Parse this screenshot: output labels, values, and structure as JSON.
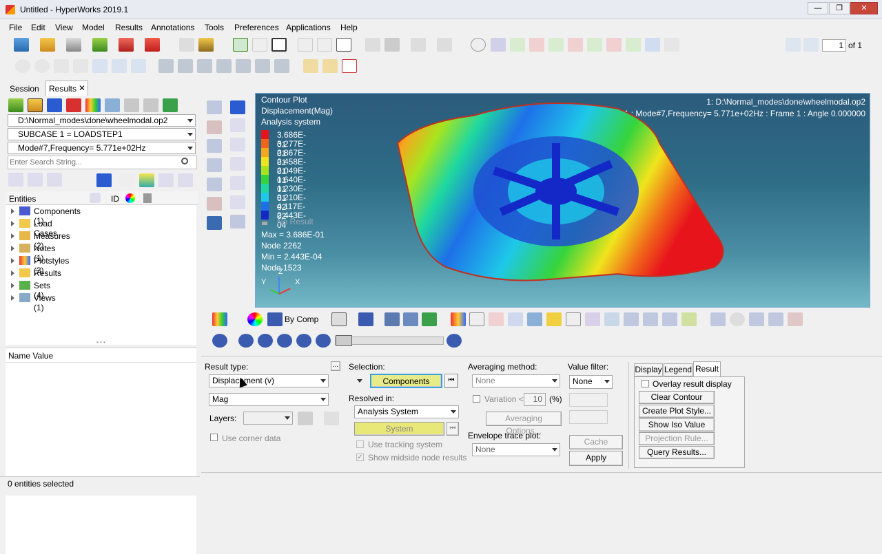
{
  "window": {
    "title": "Untitled - HyperWorks 2019.1",
    "min_glyph": "—",
    "max_glyph": "❐",
    "close_glyph": "✕"
  },
  "menu": [
    "File",
    "Edit",
    "View",
    "Model",
    "Results",
    "Annotations",
    "Tools",
    "Preferences",
    "Applications",
    "Help"
  ],
  "page_nav": {
    "current": "1",
    "total_label": "of 1"
  },
  "browser": {
    "tabs": {
      "session": "Session",
      "results": "Results",
      "close_glyph": "✕"
    },
    "file_path": "D:\\Normal_modes\\done\\wheelmodal.op2",
    "subcase": "SUBCASE 1 = LOADSTEP1",
    "mode": "Mode#7,Frequency=  5.771e+02Hz",
    "search_placeholder": "Enter Search String...",
    "columns": {
      "entities": "Entities",
      "id": "ID"
    },
    "tree": [
      {
        "label": "Components (1)",
        "icon": "components-icon"
      },
      {
        "label": "Load Cases",
        "icon": "folder-icon"
      },
      {
        "label": "Measures (2)",
        "icon": "measures-icon"
      },
      {
        "label": "Notes (1)",
        "icon": "notes-icon"
      },
      {
        "label": "Plotstyles (3)",
        "icon": "plotstyles-icon"
      },
      {
        "label": "Results",
        "icon": "folder-icon"
      },
      {
        "label": "Sets (4)",
        "icon": "sets-icon"
      },
      {
        "label": "Views (1)",
        "icon": "views-icon"
      }
    ],
    "name_value_header": "Name Value",
    "status": "0 entities selected"
  },
  "viewport": {
    "contour_title": "Contour Plot",
    "result_label": "Displacement(Mag)",
    "system_label": "Analysis system",
    "file_info": "1: D:\\Normal_modes\\done\\wheelmodal.op2",
    "subcase_info": "SUBCASE 1 = LOADSTEP1  : Mode#7,Frequency=   5.771e+02Hz : Frame 1 : Angle 0.000000",
    "legend": [
      {
        "value": "3.686E-01",
        "color": "#e8141c"
      },
      {
        "value": "3.277E-01",
        "color": "#f0641a"
      },
      {
        "value": "2.867E-01",
        "color": "#f4a81e"
      },
      {
        "value": "2.458E-01",
        "color": "#f0e41c"
      },
      {
        "value": "2.049E-01",
        "color": "#a8e41e"
      },
      {
        "value": "1.640E-01",
        "color": "#36d43c"
      },
      {
        "value": "1.230E-01",
        "color": "#1ed8a0"
      },
      {
        "value": "8.210E-02",
        "color": "#1ec8e8"
      },
      {
        "value": "4.117E-02",
        "color": "#1e70e8"
      },
      {
        "value": "2.443E-04",
        "color": "#1428c8"
      }
    ],
    "no_result": "No Result",
    "max_label": "Max =  3.686E-01",
    "max_node": "Node 2262",
    "min_label": "Min =  2.443E-04",
    "min_node": "Node 1523",
    "triad": {
      "y": "Y",
      "x": "X",
      "z": "Z"
    }
  },
  "toolbar": {
    "by_comp": "By Comp"
  },
  "result_panel": {
    "result_type_label": "Result type:",
    "result_type_value": "Displacement (v)",
    "component_value": "Mag",
    "layers_label": "Layers:",
    "use_corner_data": "Use corner data",
    "more_glyph": "...",
    "selection_label": "Selection:",
    "components_button": "Components",
    "resolved_in_label": "Resolved in:",
    "resolved_in_value": "Analysis System",
    "system_button": "System",
    "use_tracking": "Use tracking system",
    "show_midside": "Show midside node results",
    "averaging_label": "Averaging method:",
    "averaging_value": "None",
    "variation_label": "Variation <",
    "variation_value": "10",
    "variation_unit": "(%)",
    "averaging_options": "Averaging Options...",
    "envelope_label": "Envelope trace plot:",
    "envelope_value": "None",
    "value_filter_label": "Value filter:",
    "value_filter_value": "None",
    "cache_button": "Cache",
    "apply_button": "Apply",
    "tabs": {
      "display": "Display",
      "legend": "Legend",
      "result": "Result"
    },
    "overlay": "Overlay result display",
    "clear_contour": "Clear Contour",
    "create_plot_style": "Create Plot Style...",
    "show_iso_value": "Show Iso Value",
    "projection_rule": "Projection Rule...",
    "query_results": "Query Results..."
  }
}
